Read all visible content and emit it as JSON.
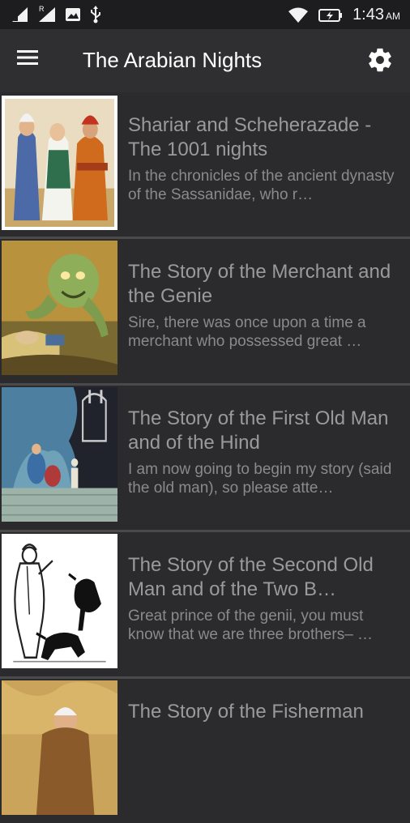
{
  "status_bar": {
    "time": "1:43",
    "ampm": "AM",
    "icons": [
      "signal-icon",
      "roaming-signal-icon",
      "image-notification-icon",
      "usb-icon",
      "wifi-icon",
      "battery-charging-icon"
    ],
    "roaming_label": "R"
  },
  "app_bar": {
    "title": "The Arabian Nights",
    "menu_icon": "hamburger-menu-icon",
    "settings_icon": "gear-icon"
  },
  "colors": {
    "background": "#2b2b2d",
    "app_bar": "#2f2f31",
    "status_bar": "#1d1d1f",
    "divider": "#4a4a4d",
    "title_text": "#9a9a9a",
    "excerpt_text": "#8a8a8a"
  },
  "stories": [
    {
      "title": "Shariar and Scheherazade - The 1001 nights",
      "excerpt": "In the chronicles of the ancient dynasty of the Sassanidae, who r…"
    },
    {
      "title": "The Story of the Merchant and the Genie",
      "excerpt": "Sire, there was once upon a time a merchant who possessed great …"
    },
    {
      "title": "The Story of the First Old Man and of the Hind",
      "excerpt": "I am now going to begin my story (said the old man), so please atte…"
    },
    {
      "title": "The Story of the Second Old Man and of the Two B…",
      "excerpt": "Great prince of the genii, you must know that we are three brothers– …"
    },
    {
      "title": "The Story of the Fisherman",
      "excerpt": ""
    }
  ]
}
